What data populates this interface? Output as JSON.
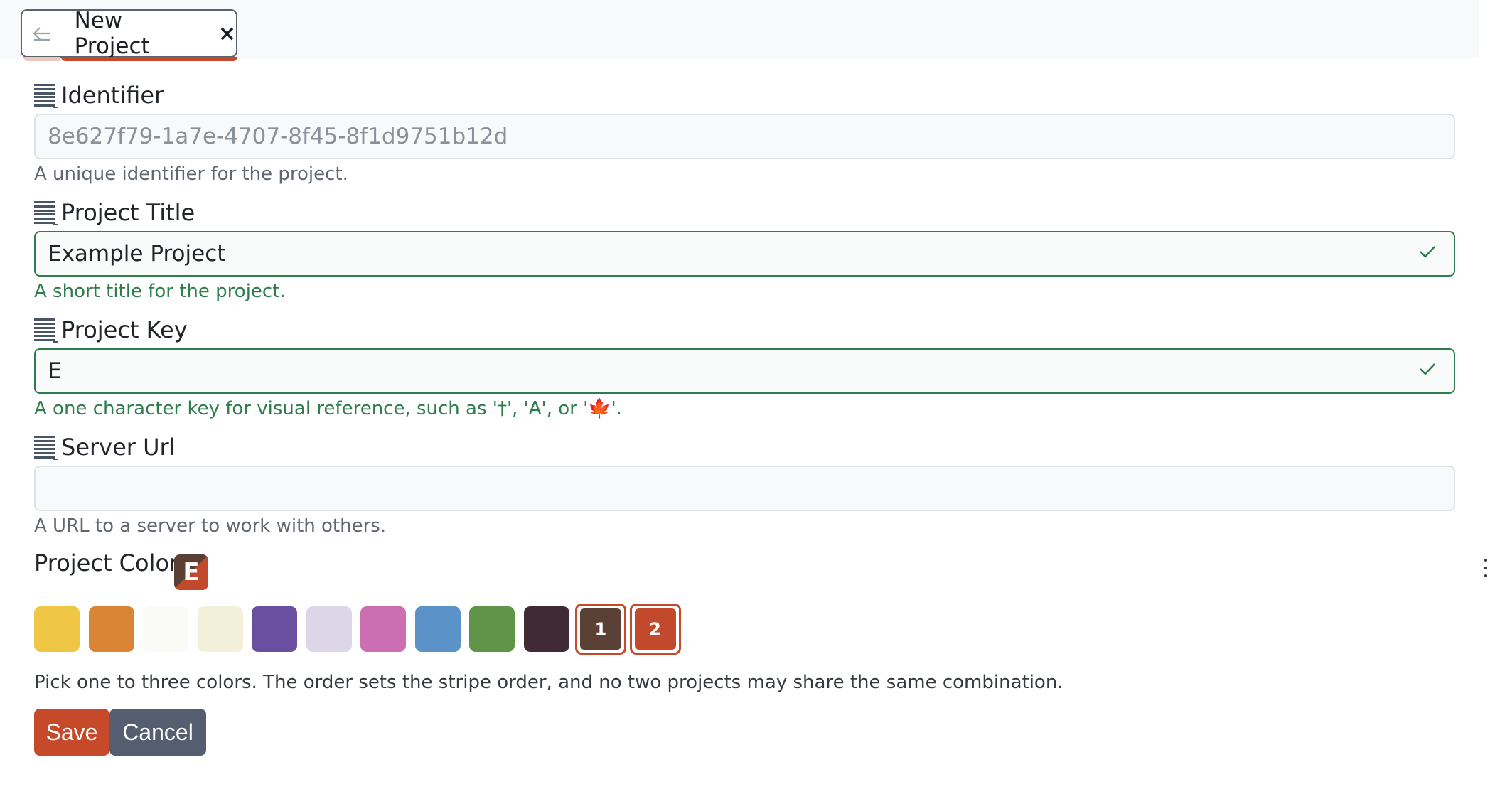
{
  "tab": {
    "back_icon": "arrow-left-icon",
    "title": "New Project",
    "close_label": "×"
  },
  "fields": {
    "identifier": {
      "label": "Identifier",
      "value": "8e627f79-1a7e-4707-8f45-8f1d9751b12d",
      "help": "A unique identifier for the project."
    },
    "title": {
      "label": "Project Title",
      "value": "Example Project",
      "help": "A short title for the project."
    },
    "key": {
      "label": "Project Key",
      "value": "E",
      "help": "A one character key for visual reference, such as '†', 'A', or '🍁'."
    },
    "server_url": {
      "label": "Server Url",
      "value": "",
      "help": "A URL to a server to work with others."
    }
  },
  "project_color": {
    "label": "Project Color",
    "badge": "E",
    "swatches": [
      {
        "color": "#f0c744"
      },
      {
        "color": "#d98535"
      },
      {
        "color": "#fafaf7"
      },
      {
        "color": "#f2efdb"
      },
      {
        "color": "#6a4fa0"
      },
      {
        "color": "#ddd6e8"
      },
      {
        "color": "#cb6fb2"
      },
      {
        "color": "#5b92c8"
      },
      {
        "color": "#609448"
      },
      {
        "color": "#402a36"
      },
      {
        "color": "#5a4035",
        "order": "1"
      },
      {
        "color": "#c2492b",
        "order": "2"
      }
    ],
    "help": "Pick one to three colors. The order sets the stripe order, and no two projects may share the same combination."
  },
  "actions": {
    "save": "Save",
    "cancel": "Cancel"
  },
  "colors": {
    "accent": "#c6492a",
    "valid": "#2f7d4f",
    "secondary": "#545e70"
  }
}
